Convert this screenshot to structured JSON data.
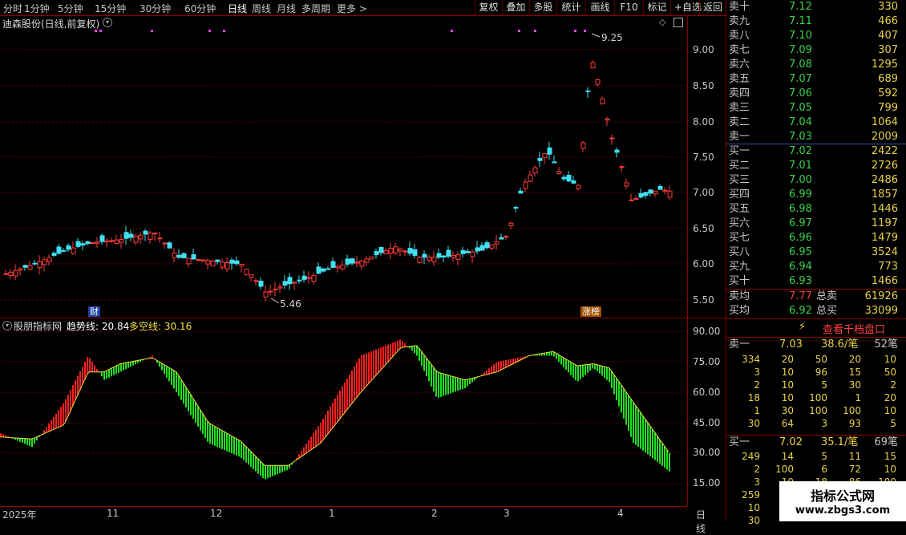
{
  "toolbar": {
    "periods": [
      "分时",
      "1分钟",
      "5分钟",
      "15分钟",
      "30分钟",
      "60分钟",
      "日线",
      "周线",
      "月线",
      "多周期",
      "更多 >"
    ],
    "buttons": [
      "复权",
      "叠加",
      "多股",
      "统计",
      "画线",
      "F10",
      "标记",
      "+自选",
      "返回"
    ]
  },
  "kpanel": {
    "title": "迪森股份(日线,前复权)",
    "high_label": "9.25",
    "low_label": "5.46",
    "y_ticks": [
      "9.00",
      "8.50",
      "8.00",
      "7.50",
      "7.00",
      "6.50",
      "6.00",
      "5.50"
    ],
    "badge_cai": "财",
    "badge_zhangbang": "涨榜"
  },
  "ipanel": {
    "name": "股朋指标网",
    "trend_label": "趋势线: 20.84",
    "ls_label": "多空线: 30.16",
    "y_ticks": [
      "90.00",
      "75.00",
      "60.00",
      "45.00",
      "30.00",
      "15.00"
    ]
  },
  "datebar": {
    "labels": [
      "2025年",
      "11",
      "12",
      "1",
      "2",
      "3",
      "4"
    ],
    "period": "日线"
  },
  "book": {
    "asks": [
      {
        "label": "卖十",
        "price": "7.12",
        "vol": "330"
      },
      {
        "label": "卖九",
        "price": "7.11",
        "vol": "466"
      },
      {
        "label": "卖八",
        "price": "7.10",
        "vol": "407"
      },
      {
        "label": "卖七",
        "price": "7.09",
        "vol": "307"
      },
      {
        "label": "卖六",
        "price": "7.08",
        "vol": "1295"
      },
      {
        "label": "卖五",
        "price": "7.07",
        "vol": "689"
      },
      {
        "label": "卖四",
        "price": "7.06",
        "vol": "592"
      },
      {
        "label": "卖三",
        "price": "7.05",
        "vol": "799"
      },
      {
        "label": "卖二",
        "price": "7.04",
        "vol": "1064"
      },
      {
        "label": "卖一",
        "price": "7.03",
        "vol": "2009"
      }
    ],
    "bids": [
      {
        "label": "买一",
        "price": "7.02",
        "vol": "2422"
      },
      {
        "label": "买二",
        "price": "7.01",
        "vol": "2726"
      },
      {
        "label": "买三",
        "price": "7.00",
        "vol": "2486"
      },
      {
        "label": "买四",
        "price": "6.99",
        "vol": "1857"
      },
      {
        "label": "买五",
        "price": "6.98",
        "vol": "1446"
      },
      {
        "label": "买六",
        "price": "6.97",
        "vol": "1197"
      },
      {
        "label": "买七",
        "price": "6.96",
        "vol": "1479"
      },
      {
        "label": "买八",
        "price": "6.95",
        "vol": "3524"
      },
      {
        "label": "买九",
        "price": "6.94",
        "vol": "773"
      },
      {
        "label": "买十",
        "price": "6.93",
        "vol": "1466"
      }
    ],
    "avg_sell": {
      "label": "卖均",
      "price": "7.77",
      "tlabel": "总卖",
      "tvol": "61926"
    },
    "avg_buy": {
      "label": "买均",
      "price": "6.92",
      "tlabel": "总买",
      "tvol": "33099"
    },
    "view_depth": "查看千档盘口",
    "sell1": {
      "label": "卖一",
      "price": "7.03",
      "avg": "38.6/笔",
      "count": "52笔"
    },
    "sell1_grid": [
      [
        "334",
        "20",
        "50",
        "20",
        "10"
      ],
      [
        "3",
        "10",
        "96",
        "15",
        "50"
      ],
      [
        "2",
        "10",
        "5",
        "30",
        "2"
      ],
      [
        "18",
        "10",
        "100",
        "1",
        "20"
      ],
      [
        "1",
        "30",
        "100",
        "100",
        "10"
      ],
      [
        "30",
        "64",
        "3",
        "93",
        "5"
      ]
    ],
    "buy1": {
      "label": "买一",
      "price": "7.02",
      "avg": "35.1/笔",
      "count": "69笔"
    },
    "buy1_grid": [
      [
        "249",
        "14",
        "5",
        "11",
        "15"
      ],
      [
        "2",
        "100",
        "6",
        "72",
        "10"
      ],
      [
        "3",
        "10",
        "18",
        "86",
        "100"
      ],
      [
        "259",
        "",
        "",
        "",
        ""
      ],
      [
        "10",
        "",
        "",
        "",
        ""
      ],
      [
        "30",
        "",
        "",
        "",
        ""
      ]
    ],
    "watermark_cn": "指标公式网",
    "watermark_url": "www.zbgs3.com"
  },
  "colors": {
    "up": "#ff3b3b",
    "down": "#40e0f0",
    "ind_up": "#ff2020",
    "ind_down": "#22e022",
    "grid": "#6a0000"
  }
}
